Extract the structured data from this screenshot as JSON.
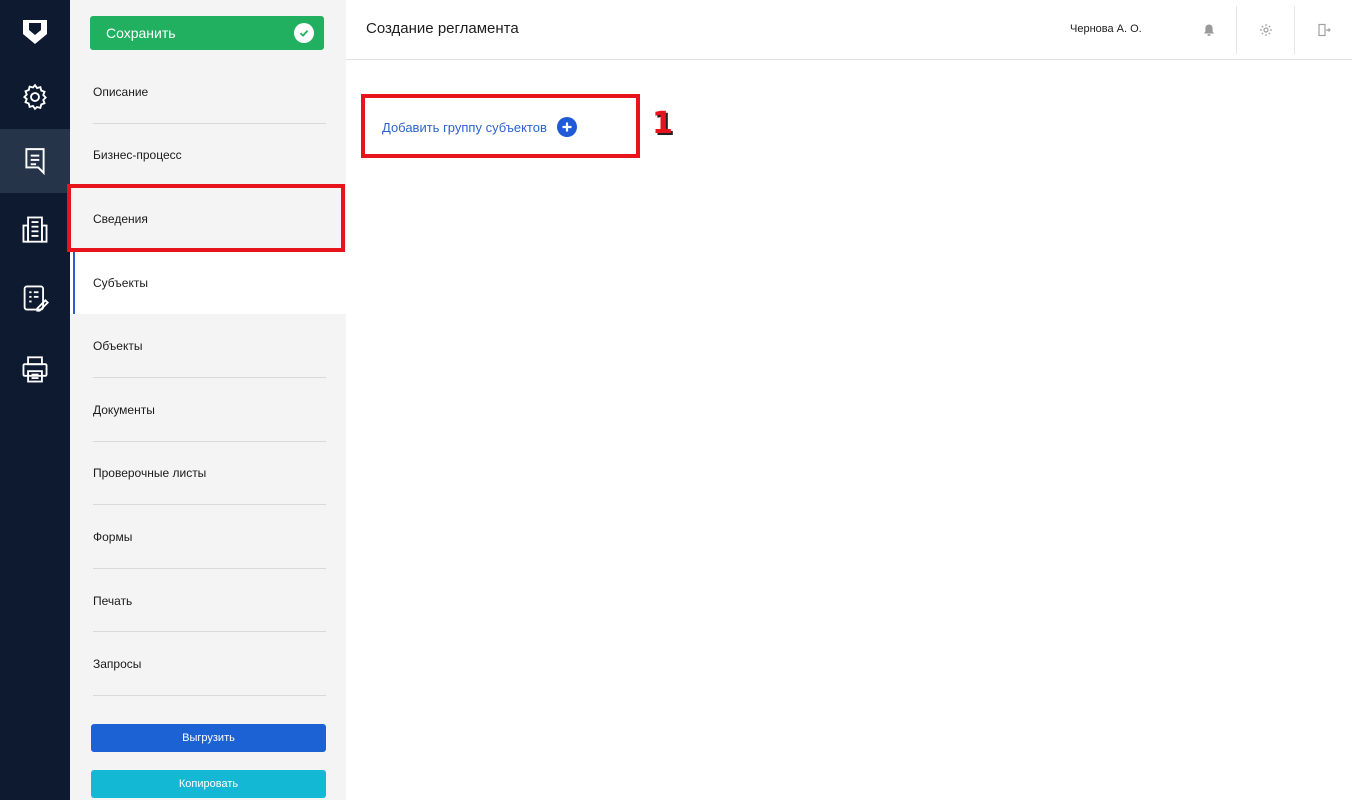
{
  "sidebar": {
    "save_label": "Сохранить",
    "items": [
      {
        "label": "Описание"
      },
      {
        "label": "Бизнес-процесс"
      },
      {
        "label": "Сведения"
      },
      {
        "label": "Субъекты",
        "active": true
      },
      {
        "label": "Объекты"
      },
      {
        "label": "Документы"
      },
      {
        "label": "Проверочные листы"
      },
      {
        "label": "Формы"
      },
      {
        "label": "Печать"
      },
      {
        "label": "Запросы"
      }
    ],
    "export_label": "Выгрузить",
    "copy_label": "Копировать"
  },
  "rail": {
    "icons": [
      "shield-logo",
      "gear-icon",
      "document-icon",
      "building-icon",
      "checklist-edit-icon",
      "printer-icon"
    ],
    "active": "document-icon"
  },
  "header": {
    "title": "Создание регламента",
    "user": "Чернова А. О.",
    "icons": [
      "bell-icon",
      "settings-icon",
      "logout-icon"
    ]
  },
  "main": {
    "add_group_label": "Добавить группу субъектов",
    "callout": "1"
  },
  "colors": {
    "rail_bg": "#0d1a30",
    "save_green": "#21b060",
    "export_blue": "#1c62d4",
    "copy_cyan": "#12b8d4",
    "link_blue": "#2d64cc",
    "highlight_red": "#e8141b"
  }
}
